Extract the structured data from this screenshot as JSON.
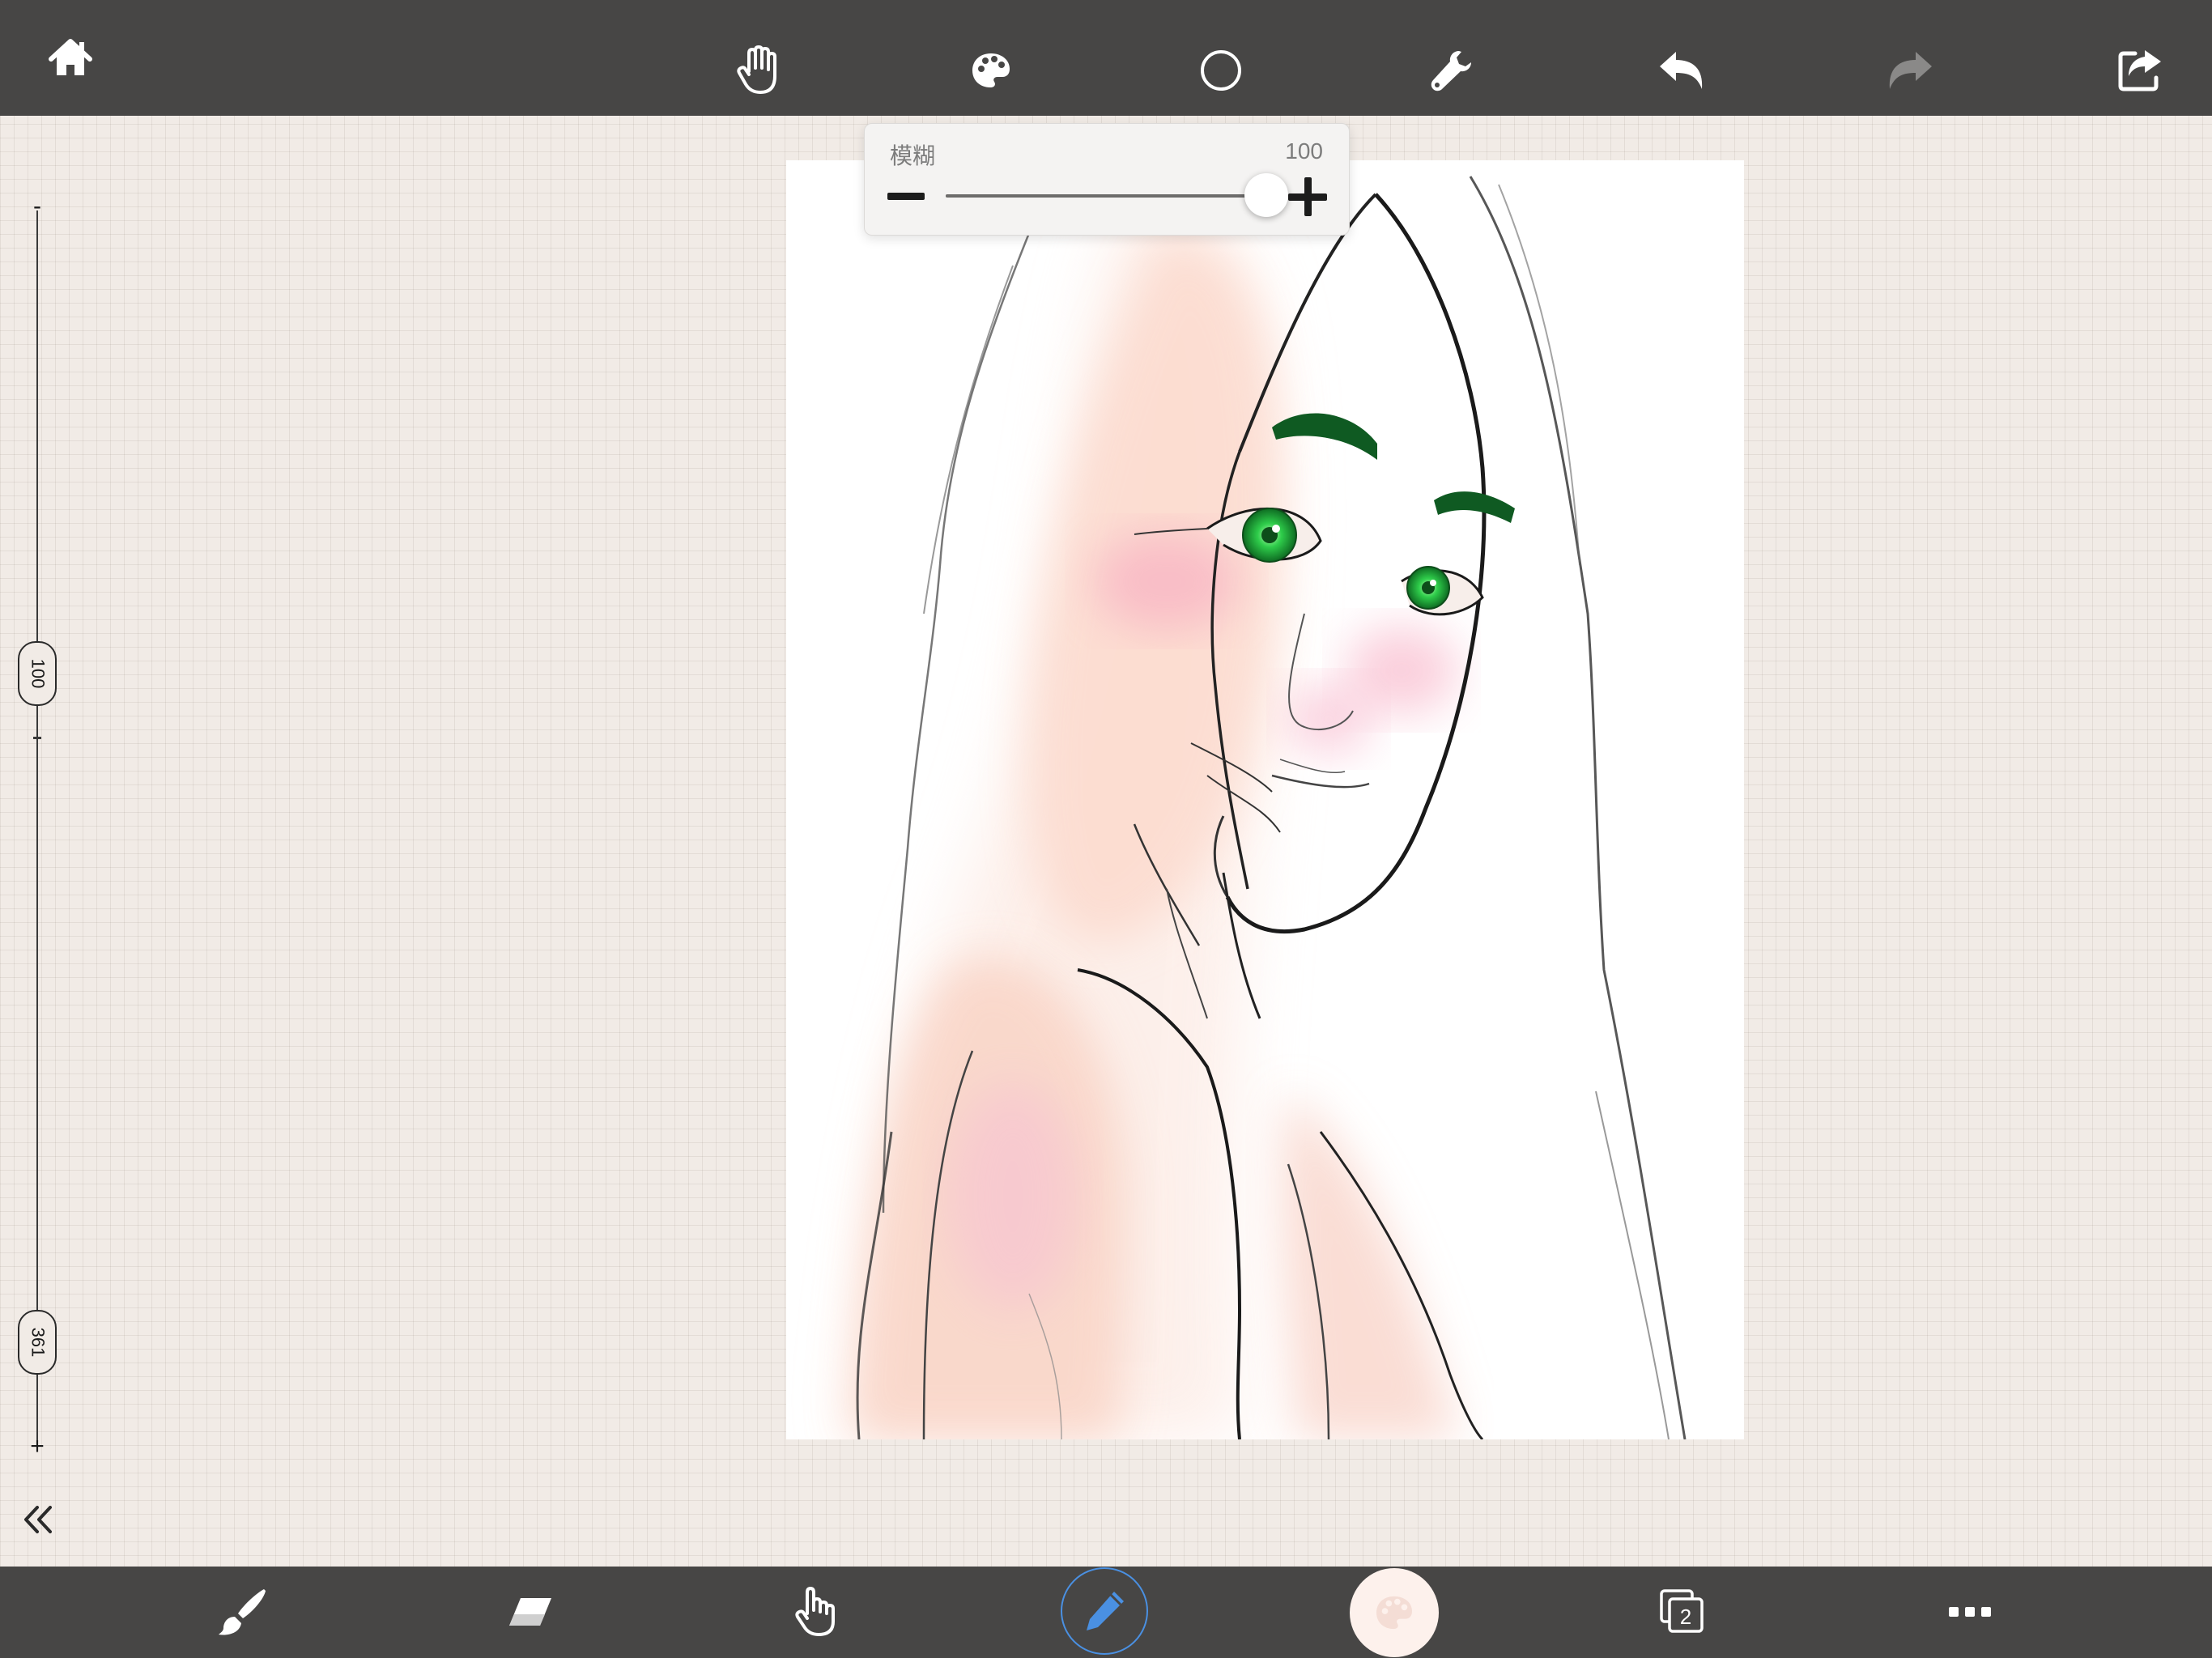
{
  "app": {
    "accent_color": "#4a90e2",
    "toolbar_color": "#474645"
  },
  "top_toolbar": {
    "icons": [
      "home-icon",
      "hand-icon",
      "palette-icon",
      "circle-selection-icon",
      "wrench-icon",
      "undo-icon",
      "redo-icon",
      "share-icon"
    ]
  },
  "blur_panel": {
    "label": "模糊",
    "value": "100",
    "level_percent": 100
  },
  "size_slider": {
    "current_size": "100",
    "max_size": "361",
    "minus_label": "-",
    "plus_label": "+",
    "level_fraction": 0.28
  },
  "bottom_toolbar": {
    "icons": [
      "brush-icon",
      "eraser-icon",
      "smudge-finger-icon",
      "pencil-icon",
      "color-palette-icon",
      "layers-icon",
      "more-icon"
    ],
    "layer_count": "2",
    "current_color": "#fdf1ec"
  }
}
